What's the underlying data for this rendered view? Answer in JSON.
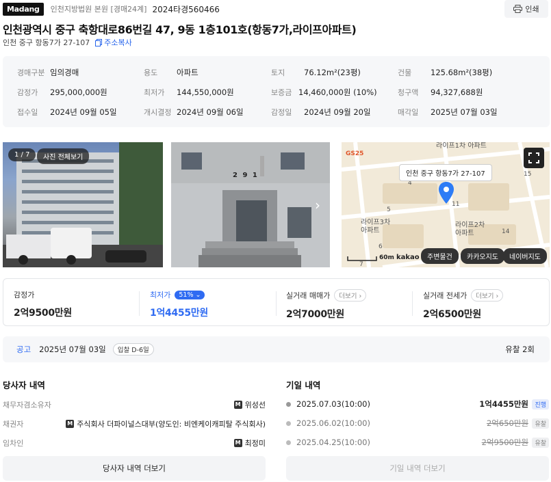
{
  "header": {
    "logo": "Madang",
    "court": "인천지방법원 본원 [경매24계]",
    "case_no": "2024타경560466",
    "print_label": "인쇄"
  },
  "title": "인천광역시 중구 축항대로86번길 47, 9동 1층101호(항동7가,라이프아파트)",
  "address": {
    "short": "인천 중구 항동7가 27-107",
    "copy_label": "주소복사"
  },
  "info": [
    {
      "k": "경매구분",
      "v": "임의경매"
    },
    {
      "k": "용도",
      "v": "아파트"
    },
    {
      "k": "토지",
      "v": "76.12m²(23평)"
    },
    {
      "k": "건물",
      "v": "125.68m²(38평)"
    },
    {
      "k": "감정가",
      "v": "295,000,000원"
    },
    {
      "k": "최저가",
      "v": "144,550,000원"
    },
    {
      "k": "보증금",
      "v": "14,460,000원 (10%)"
    },
    {
      "k": "청구액",
      "v": "94,327,688원"
    },
    {
      "k": "접수일",
      "v": "2024년 09월 05일"
    },
    {
      "k": "개시결정",
      "v": "2024년 09월 06일"
    },
    {
      "k": "감정일",
      "v": "2024년 09월 20일"
    },
    {
      "k": "매각일",
      "v": "2025년 07월 03일"
    }
  ],
  "photos": {
    "counter": "1 / 7",
    "view_all": "사진 전체보기",
    "building_no": "2 9 1"
  },
  "map": {
    "tooltip": "인천 중구 항동7가 27-107",
    "labels": [
      "라이프1차 아파트",
      "라이프3차 아파트",
      "라이프2차 아파트",
      "GS25"
    ],
    "scale": "60m",
    "brand": "kakao",
    "buttons": [
      "주변물건",
      "카카오지도",
      "네이버지도"
    ],
    "numbers": [
      "15",
      "4",
      "11",
      "5",
      "6",
      "14",
      "7"
    ]
  },
  "prices": [
    {
      "label": "감정가",
      "value": "2억9500만원"
    },
    {
      "label": "최저가",
      "value": "1억4455만원",
      "badge": "51%"
    },
    {
      "label": "실거래 매매가",
      "value": "2억7000만원",
      "more": "더보기"
    },
    {
      "label": "실거래 전세가",
      "value": "2억6500만원",
      "more": "더보기"
    }
  ],
  "notice": {
    "label": "공고",
    "date": "2025년 07월 03일",
    "dday": "입찰 D-6일",
    "fail": "유찰 2회"
  },
  "parties": {
    "title": "당사자 내역",
    "rows": [
      {
        "k": "채무자겸소유자",
        "v": "위성선"
      },
      {
        "k": "채권자",
        "v": "주식회사 더파이널스대부(양도인: 비엔케이캐피탈 주식회사)"
      },
      {
        "k": "임차인",
        "v": "최정미"
      }
    ],
    "more": "당사자 내역 더보기",
    "m_mark": "M"
  },
  "history": {
    "title": "기일 내역",
    "rows": [
      {
        "date": "2025.07.03(10:00)",
        "price": "1억4455만원",
        "status": "진행"
      },
      {
        "date": "2025.06.02(10:00)",
        "price": "2억650만원",
        "status": "유찰"
      },
      {
        "date": "2025.04.25(10:00)",
        "price": "2억9500만원",
        "status": "유찰"
      }
    ],
    "more": "기일 내역 더보기"
  },
  "colors": {
    "accent": "#2f6bf2",
    "marker": "#2d7cf6"
  }
}
